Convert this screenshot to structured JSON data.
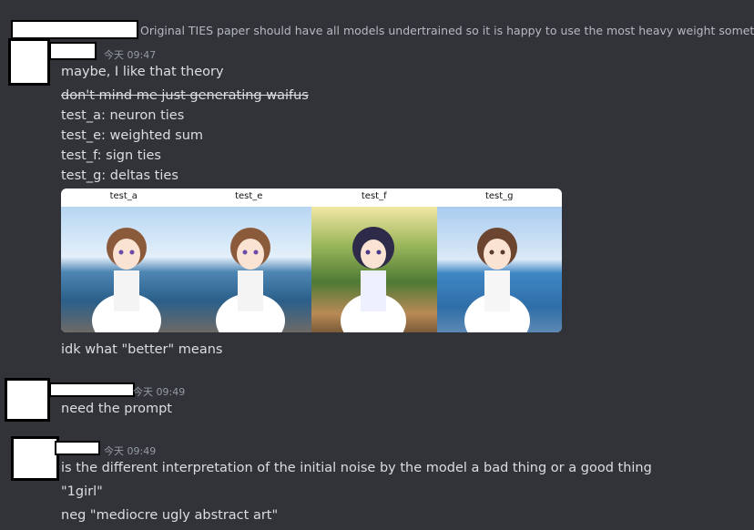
{
  "reply_preview": {
    "text": "Original TIES paper should have all models undertrained so it is happy to use the most heavy weight sometimes"
  },
  "messages": [
    {
      "timestamp": "今天 09:47",
      "lines": [
        "maybe, I like that theory",
        "don't mind me just generating waifus",
        "test_a: neuron ties",
        "test_e: weighted sum",
        "test_f: sign ties",
        "test_g: deltas ties"
      ],
      "image_grid": {
        "columns": [
          "test_a",
          "test_e",
          "test_f",
          "test_g"
        ]
      },
      "after_image": "idk what \"better\" means"
    },
    {
      "timestamp": "今天 09:49",
      "lines": [
        "need the prompt"
      ]
    },
    {
      "timestamp": "今天 09:49",
      "lines": [
        "is the different interpretation of the initial noise by the model a bad thing or a good thing",
        "\"1girl\"",
        "neg \"mediocre ugly abstract art\""
      ]
    }
  ],
  "colors": {
    "background": "#313338",
    "text": "#dbdee1",
    "muted": "#949ba4"
  }
}
